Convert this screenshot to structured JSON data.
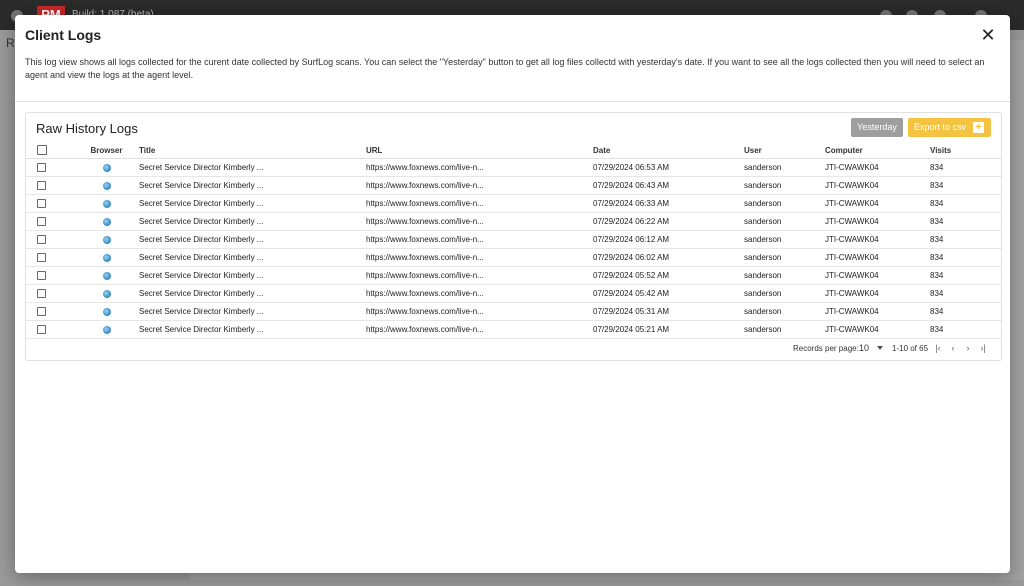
{
  "app": {
    "logo_text": "PM",
    "build_text": "Build: 1.087 (beta)",
    "bg_label": "R"
  },
  "modal": {
    "title": "Client Logs",
    "description": "This log view shows all logs collected for the curent date collected by SurfLog scans. You can select the \"Yesterday\" button to get all log files collectd with yesterday's date. If you want to see all the logs collected then you will need to select an agent and view the logs at the agent level.",
    "card_title": "Raw History Logs",
    "yesterday_label": "Yesterday",
    "export_label": "Export to csv"
  },
  "table": {
    "columns": [
      "Browser",
      "Title",
      "URL",
      "Date",
      "User",
      "Computer",
      "Visits"
    ],
    "rows": [
      {
        "title": "Secret Service Director Kimberly ...",
        "url": "https://www.foxnews.com/live-n...",
        "date": "07/29/2024 06:53 AM",
        "user": "sanderson",
        "computer": "JTI-CWAWK04",
        "visits": "834"
      },
      {
        "title": "Secret Service Director Kimberly ...",
        "url": "https://www.foxnews.com/live-n...",
        "date": "07/29/2024 06:43 AM",
        "user": "sanderson",
        "computer": "JTI-CWAWK04",
        "visits": "834"
      },
      {
        "title": "Secret Service Director Kimberly ...",
        "url": "https://www.foxnews.com/live-n...",
        "date": "07/29/2024 06:33 AM",
        "user": "sanderson",
        "computer": "JTI-CWAWK04",
        "visits": "834"
      },
      {
        "title": "Secret Service Director Kimberly ...",
        "url": "https://www.foxnews.com/live-n...",
        "date": "07/29/2024 06:22 AM",
        "user": "sanderson",
        "computer": "JTI-CWAWK04",
        "visits": "834"
      },
      {
        "title": "Secret Service Director Kimberly ...",
        "url": "https://www.foxnews.com/live-n...",
        "date": "07/29/2024 06:12 AM",
        "user": "sanderson",
        "computer": "JTI-CWAWK04",
        "visits": "834"
      },
      {
        "title": "Secret Service Director Kimberly ...",
        "url": "https://www.foxnews.com/live-n...",
        "date": "07/29/2024 06:02 AM",
        "user": "sanderson",
        "computer": "JTI-CWAWK04",
        "visits": "834"
      },
      {
        "title": "Secret Service Director Kimberly ...",
        "url": "https://www.foxnews.com/live-n...",
        "date": "07/29/2024 05:52 AM",
        "user": "sanderson",
        "computer": "JTI-CWAWK04",
        "visits": "834"
      },
      {
        "title": "Secret Service Director Kimberly ...",
        "url": "https://www.foxnews.com/live-n...",
        "date": "07/29/2024 05:42 AM",
        "user": "sanderson",
        "computer": "JTI-CWAWK04",
        "visits": "834"
      },
      {
        "title": "Secret Service Director Kimberly ...",
        "url": "https://www.foxnews.com/live-n...",
        "date": "07/29/2024 05:31 AM",
        "user": "sanderson",
        "computer": "JTI-CWAWK04",
        "visits": "834"
      },
      {
        "title": "Secret Service Director Kimberly ...",
        "url": "https://www.foxnews.com/live-n...",
        "date": "07/29/2024 05:21 AM",
        "user": "sanderson",
        "computer": "JTI-CWAWK04",
        "visits": "834"
      }
    ]
  },
  "pager": {
    "records_per_page_label": "Records per page:",
    "records_per_page_value": "10",
    "range_text": "1-10 of 65"
  },
  "icons": {
    "browser": "browser-globe-icon",
    "close": "close-icon",
    "export": "export-plus-icon"
  },
  "colors": {
    "yesterday_button": "#9e9e9e",
    "export_button": "#f5c342"
  }
}
